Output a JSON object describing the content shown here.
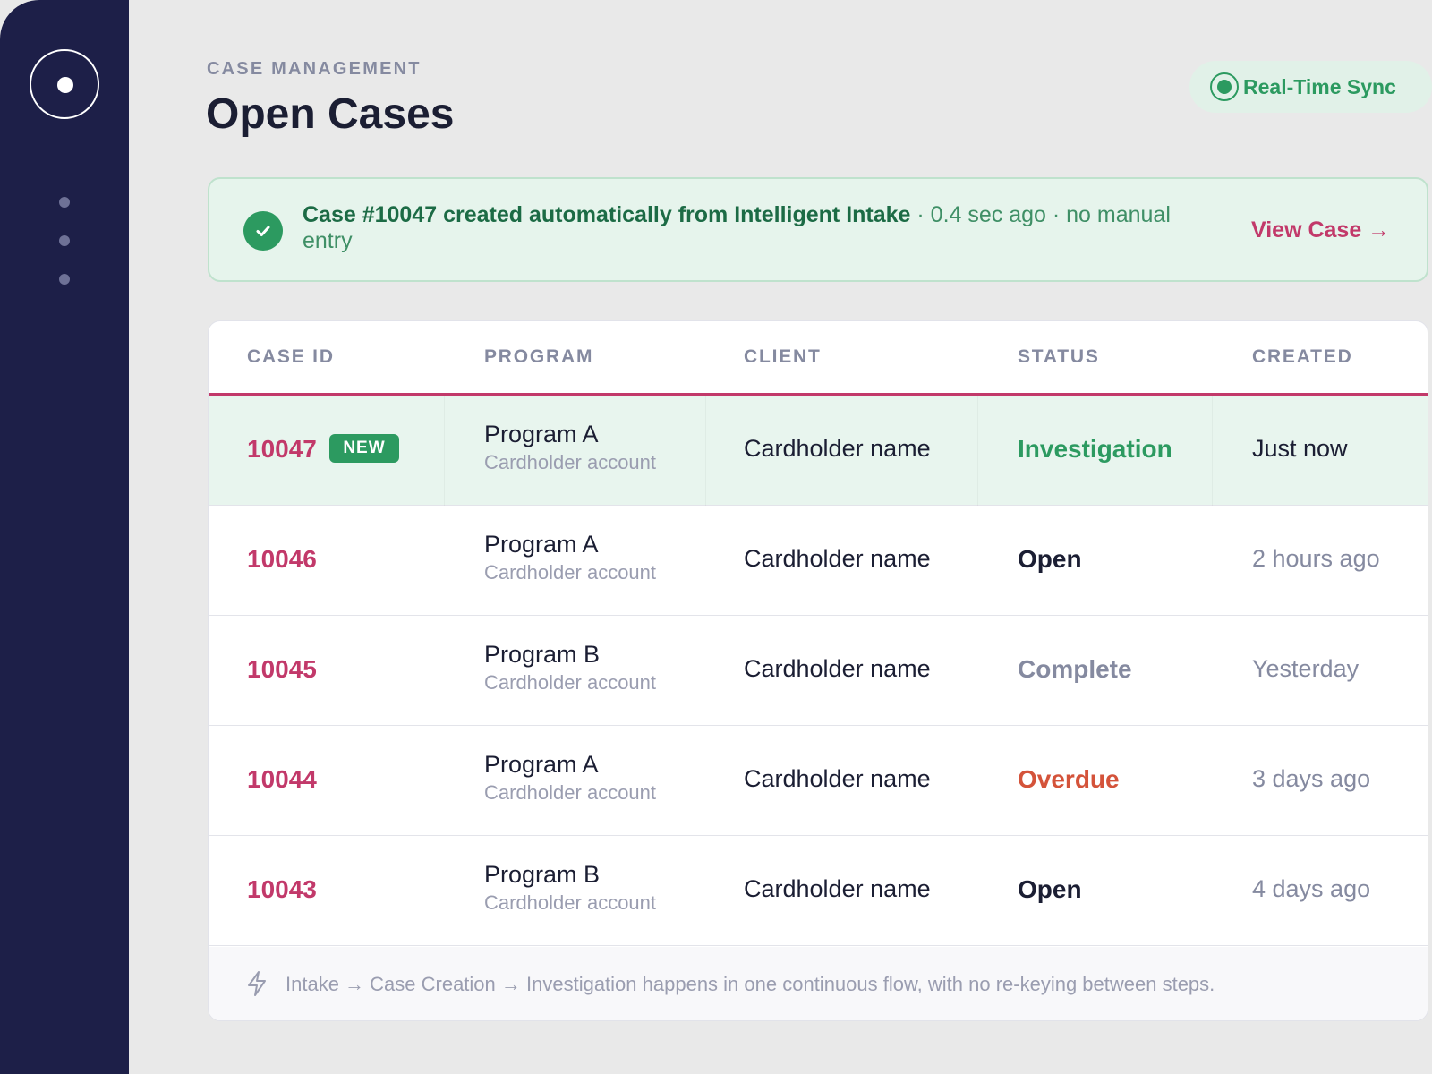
{
  "header": {
    "eyebrow": "CASE MANAGEMENT",
    "title": "Open Cases",
    "sync_label": "Real-Time Sync"
  },
  "alert": {
    "main": "Case #10047 created automatically from Intelligent Intake",
    "meta": " · 0.4 sec ago · no manual entry",
    "action": "View Case →"
  },
  "table": {
    "columns": [
      "CASE ID",
      "PROGRAM",
      "CLIENT",
      "STATUS",
      "CREATED"
    ],
    "new_badge": "NEW",
    "rows": [
      {
        "id": "10047",
        "program": "Program A",
        "account": "Cardholder account",
        "client": "Cardholder name",
        "status": "Investigation",
        "created": "Just now"
      },
      {
        "id": "10046",
        "program": "Program A",
        "account": "Cardholder account",
        "client": "Cardholder name",
        "status": "Open",
        "created": "2 hours ago"
      },
      {
        "id": "10045",
        "program": "Program B",
        "account": "Cardholder account",
        "client": "Cardholder name",
        "status": "Complete",
        "created": "Yesterday"
      },
      {
        "id": "10044",
        "program": "Program A",
        "account": "Cardholder account",
        "client": "Cardholder name",
        "status": "Overdue",
        "created": "3 days ago"
      },
      {
        "id": "10043",
        "program": "Program B",
        "account": "Cardholder account",
        "client": "Cardholder name",
        "status": "Open",
        "created": "4 days ago"
      }
    ]
  },
  "footer": {
    "text": "Intake → Case Creation → Investigation happens in one continuous flow, with no re-keying between steps."
  },
  "colors": {
    "sidebar": "#1d1f48",
    "accent": "#c2396a",
    "success": "#2c9a60",
    "investigation": "#2c9a60",
    "open": "#1b1e33",
    "complete": "#858aa0",
    "overdue": "#d4533a"
  },
  "icons": {
    "logo": "circle-dot-icon",
    "sync": "live-dot-icon",
    "alert": "check-circle-icon",
    "footer": "lightning-icon"
  }
}
